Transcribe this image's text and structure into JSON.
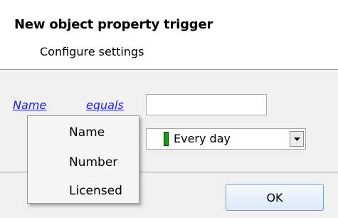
{
  "dialog": {
    "title": "New object property trigger",
    "subtitle": "Configure settings"
  },
  "condition": {
    "property_link": "Name",
    "operator_link": "equals",
    "value": "",
    "schedule_selected": "Every day",
    "schedule_swatch_color": "#00aa00"
  },
  "context_menu": {
    "items": [
      "Name",
      "Number",
      "Licensed"
    ]
  },
  "buttons": {
    "ok_label": "OK"
  }
}
